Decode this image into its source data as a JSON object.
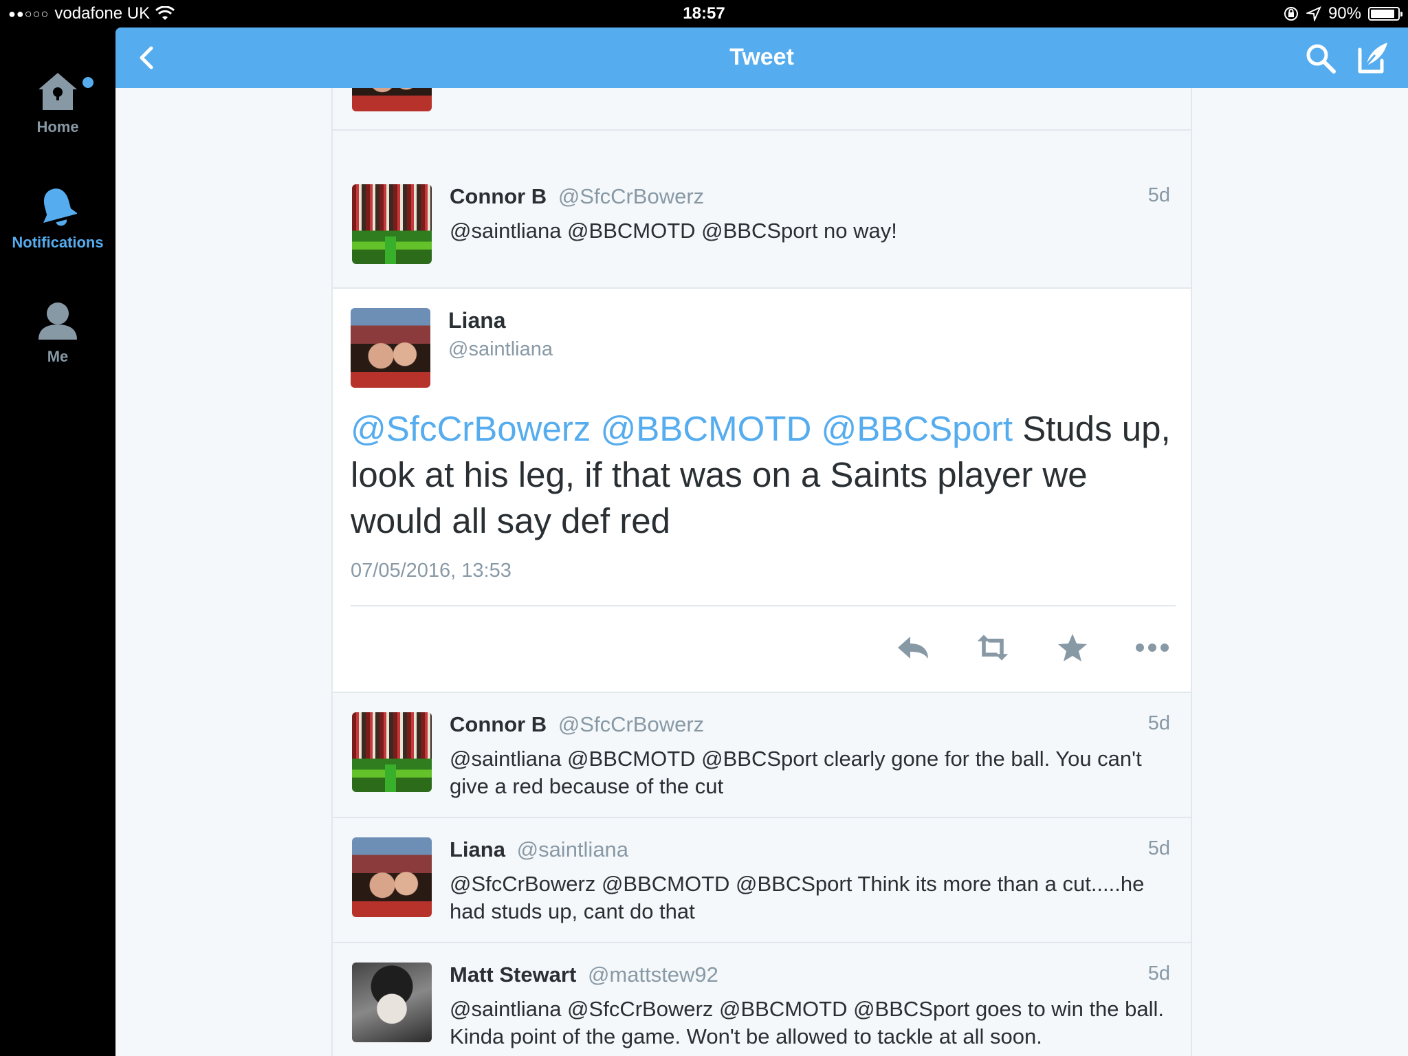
{
  "status_bar": {
    "carrier": "vodafone UK",
    "signal_dots": "●●○○○",
    "time": "18:57",
    "battery": "90%",
    "battery_level": 0.9
  },
  "sidebar": {
    "items": [
      {
        "label": "Home",
        "icon": "home-icon",
        "active": false
      },
      {
        "label": "Notifications",
        "icon": "bell-icon",
        "active": true
      },
      {
        "label": "Me",
        "icon": "person-icon",
        "active": false
      }
    ]
  },
  "topbar": {
    "title": "Tweet"
  },
  "colors": {
    "accent": "#55acee",
    "text": "#292f33",
    "muted": "#8899a6",
    "background": "#f5f8fa"
  },
  "tweets_above": [
    {
      "name": "Connor B",
      "handle": "@SfcCrBowerz",
      "age": "5d",
      "text": "@saintliana @BBCMOTD @BBCSport no way!"
    }
  ],
  "focused_tweet": {
    "name": "Liana",
    "handle": "@saintliana",
    "mentions": [
      "@SfcCrBowerz",
      "@BBCMOTD",
      "@BBCSport"
    ],
    "text": "Studs up, look at his leg, if that was on a Saints player we would all say def red",
    "date": "07/05/2016, 13:53",
    "actions": [
      "reply-icon",
      "retweet-icon",
      "favorite-star-icon",
      "more-icon"
    ]
  },
  "replies": [
    {
      "name": "Connor B",
      "handle": "@SfcCrBowerz",
      "age": "5d",
      "text": "@saintliana @BBCMOTD @BBCSport clearly gone for the ball. You can't give a red because of the cut"
    },
    {
      "name": "Liana",
      "handle": "@saintliana",
      "age": "5d",
      "text": "@SfcCrBowerz @BBCMOTD @BBCSport Think its more than a cut.....he had studs up, cant do that"
    },
    {
      "name": "Matt Stewart",
      "handle": "@mattstew92",
      "age": "5d",
      "text": "@saintliana @SfcCrBowerz @BBCMOTD @BBCSport goes to win the ball. Kinda point of the game. Won't be allowed to tackle at all soon."
    }
  ]
}
